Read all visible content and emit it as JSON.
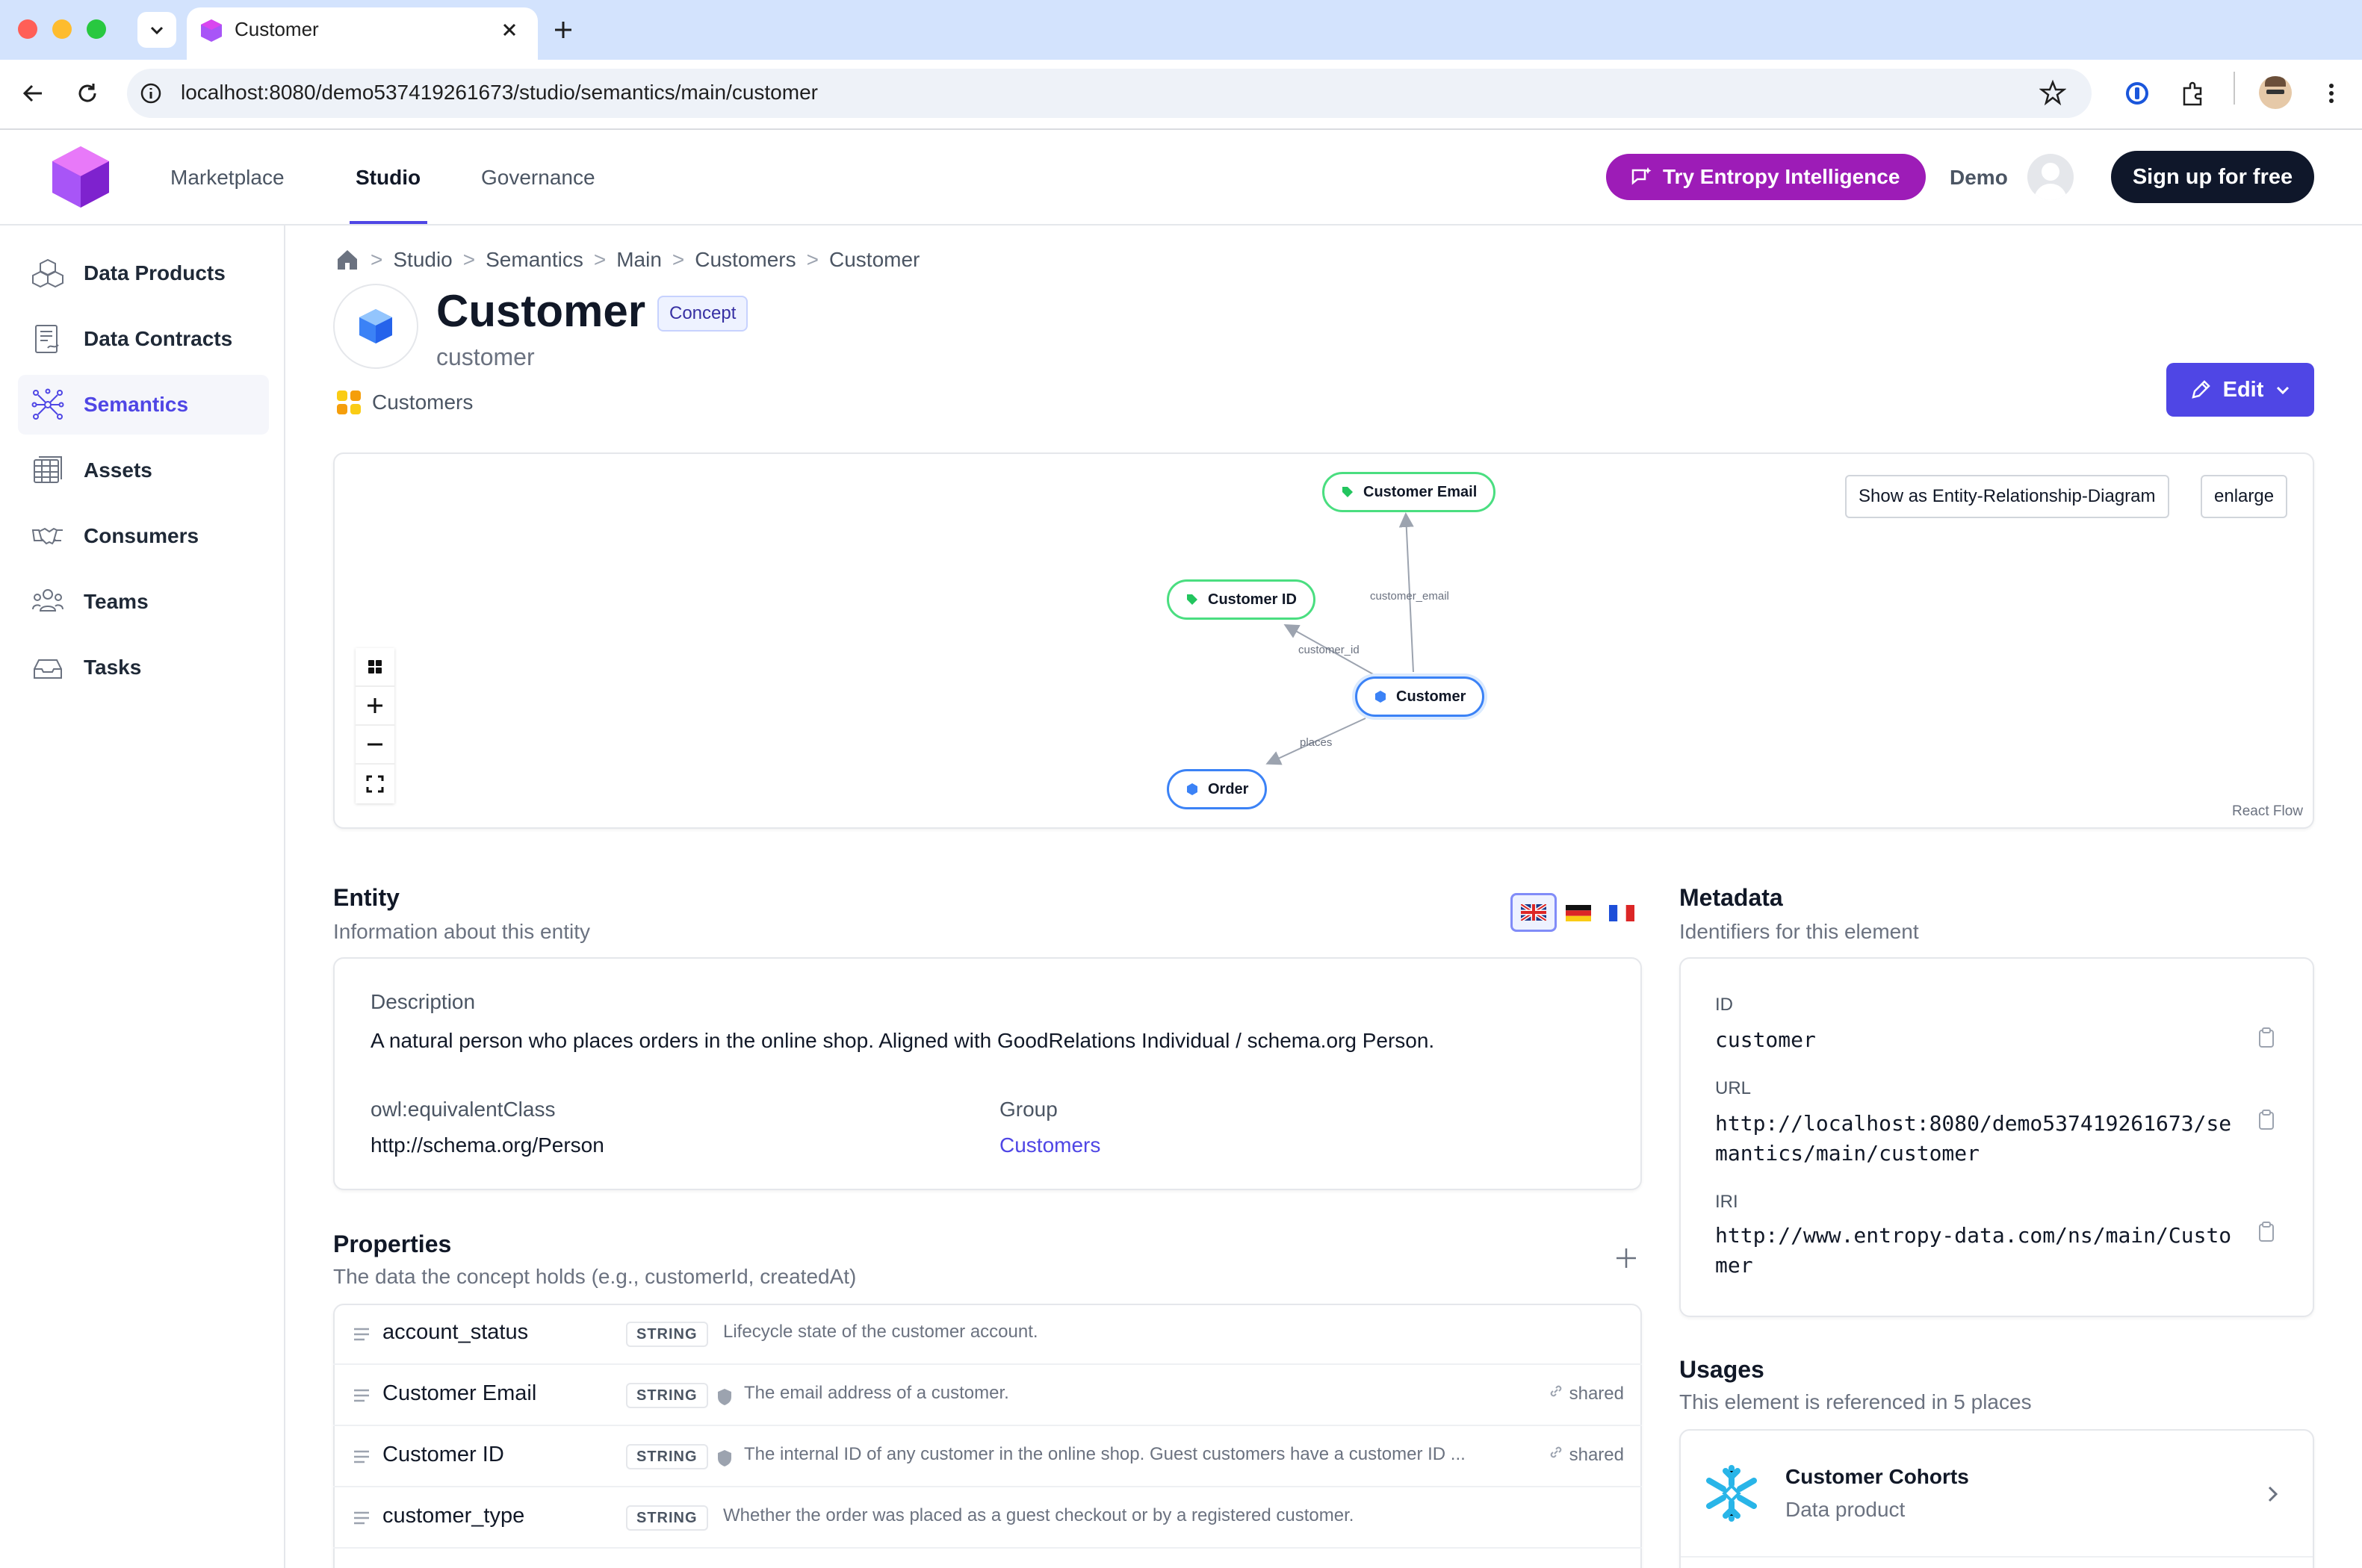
{
  "browser": {
    "tab_title": "Customer",
    "url": "localhost:8080/demo537419261673/studio/semantics/main/customer"
  },
  "header": {
    "nav": [
      {
        "label": "Marketplace"
      },
      {
        "label": "Studio"
      },
      {
        "label": "Governance"
      }
    ],
    "try_button": "Try Entropy Intelligence",
    "user_name": "Demo",
    "signup_button": "Sign up for free"
  },
  "sidebar": {
    "items": [
      {
        "label": "Data Products",
        "icon": "cube-cluster-icon"
      },
      {
        "label": "Data Contracts",
        "icon": "contract-icon"
      },
      {
        "label": "Semantics",
        "icon": "network-icon",
        "active": true
      },
      {
        "label": "Assets",
        "icon": "table-icon"
      },
      {
        "label": "Consumers",
        "icon": "handshake-icon"
      },
      {
        "label": "Teams",
        "icon": "people-icon"
      },
      {
        "label": "Tasks",
        "icon": "inbox-icon"
      }
    ]
  },
  "breadcrumb": [
    "Studio",
    "Semantics",
    "Main",
    "Customers",
    "Customer"
  ],
  "page": {
    "title": "Customer",
    "badge": "Concept",
    "subtitle": "customer",
    "group": "Customers",
    "edit_button": "Edit"
  },
  "graph": {
    "er_button": "Show as Entity-Relationship-Diagram",
    "enlarge_button": "enlarge",
    "attribution": "React Flow",
    "nodes": {
      "email": "Customer Email",
      "id": "Customer ID",
      "customer": "Customer",
      "order": "Order"
    },
    "edges": {
      "email": "customer_email",
      "id": "customer_id",
      "places": "places"
    }
  },
  "entity": {
    "title": "Entity",
    "subtitle": "Information about this entity",
    "description_label": "Description",
    "description": "A natural person who places orders in the online shop. Aligned with GoodRelations Individual / schema.org Person.",
    "equiv_label": "owl:equivalentClass",
    "equiv_value": "http://schema.org/Person",
    "group_label": "Group",
    "group_value": "Customers"
  },
  "properties": {
    "title": "Properties",
    "subtitle": "The data the concept holds (e.g., customerId, createdAt)",
    "rows": [
      {
        "name": "account_status",
        "type": "STRING",
        "description": "Lifecycle state of the customer account.",
        "shared": ""
      },
      {
        "name": "Customer Email",
        "type": "STRING",
        "description": "The email address of a customer.",
        "shared": "shared"
      },
      {
        "name": "Customer ID",
        "type": "STRING",
        "description": "The internal ID of any customer in the online shop. Guest customers have a customer ID ...",
        "shared": "shared"
      },
      {
        "name": "customer_type",
        "type": "STRING",
        "description": "Whether the order was placed as a guest checkout or by a registered customer.",
        "shared": ""
      }
    ]
  },
  "metadata": {
    "title": "Metadata",
    "subtitle": "Identifiers for this element",
    "id_label": "ID",
    "id_value": "customer",
    "url_label": "URL",
    "url_line1": "http://localhost:8080/demo537419261673/se",
    "url_line2": "mantics/main/customer",
    "iri_label": "IRI",
    "iri_line1": "http://www.entropy-data.com/ns/main/Custo",
    "iri_line2": "mer"
  },
  "usages": {
    "title": "Usages",
    "subtitle": "This element is referenced in 5 places",
    "items": [
      {
        "title": "Customer Cohorts",
        "subtitle": "Data product",
        "icon": "snowflake-icon"
      }
    ]
  },
  "colors": {
    "accent": "#4f46e5",
    "try_button": "#9d1cb7",
    "node_blue": "#3b82f6",
    "node_green": "#4ade80"
  }
}
